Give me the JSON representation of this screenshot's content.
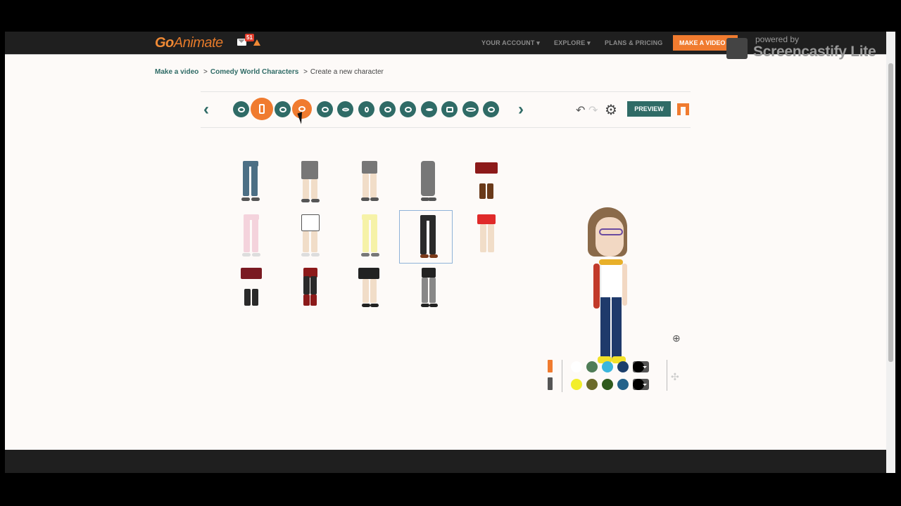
{
  "header": {
    "logo_go": "Go",
    "logo_rest": "Animate",
    "notification_count": "51",
    "nav": [
      "YOUR ACCOUNT ▾",
      "EXPLORE ▾",
      "PLANS & PRICING"
    ],
    "make_video": "MAKE A VIDEO"
  },
  "breadcrumb": {
    "items": [
      "Make a video",
      "Comedy World Characters",
      "Create a new character"
    ],
    "separator": ">"
  },
  "toolbar": {
    "prev_icon": "chevron-left-icon",
    "next_icon": "chevron-right-icon",
    "categories": [
      "shirt",
      "pants",
      "head",
      "hair",
      "face-shape",
      "mouth",
      "nose",
      "chin",
      "eye",
      "eyebrow",
      "accessory",
      "glasses",
      "beard"
    ],
    "active_category": "pants",
    "preview_label": "PREVIEW",
    "accent_color": "#f07b2f",
    "primary_color": "#2f6b66"
  },
  "items": {
    "count": 14,
    "selected_index": 8
  },
  "colors": {
    "row1": [
      "#ffffff",
      "#4f7d57",
      "#3ab6dc",
      "#1c3f6b",
      "#000000"
    ],
    "row2": [
      "#f2ee2a",
      "#6b6a2a",
      "#2f5a1e",
      "#23628a",
      "#000000"
    ]
  },
  "watermark": {
    "small": "powered by",
    "big": "Screencastify Lite"
  }
}
